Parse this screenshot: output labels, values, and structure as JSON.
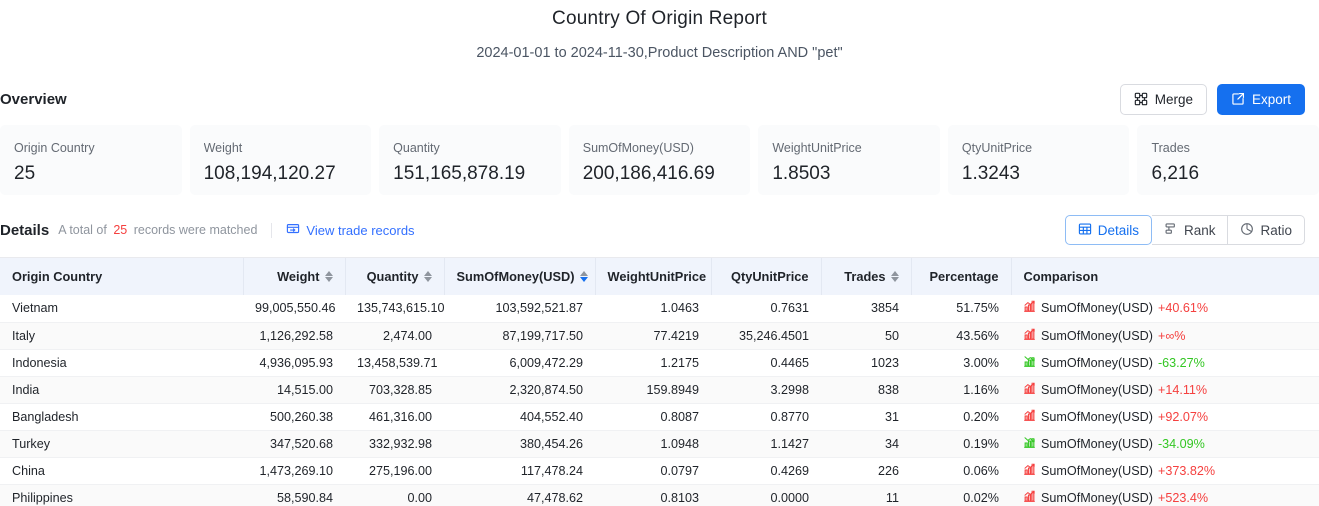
{
  "report": {
    "title": "Country Of Origin Report",
    "subtitle": "2024-01-01 to 2024-11-30,Product Description AND \"pet\""
  },
  "overview": {
    "label": "Overview",
    "merge_label": "Merge",
    "export_label": "Export",
    "cards": [
      {
        "label": "Origin Country",
        "value": "25"
      },
      {
        "label": "Weight",
        "value": "108,194,120.27"
      },
      {
        "label": "Quantity",
        "value": "151,165,878.19"
      },
      {
        "label": "SumOfMoney(USD)",
        "value": "200,186,416.69"
      },
      {
        "label": "WeightUnitPrice",
        "value": "1.8503"
      },
      {
        "label": "QtyUnitPrice",
        "value": "1.3243"
      },
      {
        "label": "Trades",
        "value": "6,216"
      }
    ]
  },
  "details": {
    "title": "Details",
    "meta_prefix": "A total of",
    "count": "25",
    "meta_suffix": "records were matched",
    "trade_link": "View trade records",
    "views": [
      {
        "label": "Details",
        "icon": "grid-icon",
        "active": true
      },
      {
        "label": "Rank",
        "icon": "rank-icon",
        "active": false
      },
      {
        "label": "Ratio",
        "icon": "pie-icon",
        "active": false
      }
    ]
  },
  "table": {
    "columns": [
      {
        "label": "Origin Country",
        "align": "left",
        "sortable": false,
        "sort": "none"
      },
      {
        "label": "Weight",
        "align": "right",
        "sortable": true,
        "sort": "none"
      },
      {
        "label": "Quantity",
        "align": "right",
        "sortable": true,
        "sort": "none"
      },
      {
        "label": "SumOfMoney(USD)",
        "align": "right",
        "sortable": true,
        "sort": "desc"
      },
      {
        "label": "WeightUnitPrice",
        "align": "right",
        "sortable": false,
        "sort": "none"
      },
      {
        "label": "QtyUnitPrice",
        "align": "right",
        "sortable": false,
        "sort": "none"
      },
      {
        "label": "Trades",
        "align": "right",
        "sortable": true,
        "sort": "none"
      },
      {
        "label": "Percentage",
        "align": "right",
        "sortable": false,
        "sort": "none"
      },
      {
        "label": "Comparison",
        "align": "left",
        "sortable": false,
        "sort": "none"
      }
    ],
    "rows": [
      {
        "country": "Vietnam",
        "weight": "99,005,550.46",
        "quantity": "135,743,615.10",
        "sum_of_money": "103,592,521.87",
        "weight_unit_price": "1.0463",
        "qty_unit_price": "0.7631",
        "trades": "3854",
        "percentage": "51.75%",
        "comparison_label": "SumOfMoney(USD)",
        "comparison_delta": "+40.61%",
        "direction": "up"
      },
      {
        "country": "Italy",
        "weight": "1,126,292.58",
        "quantity": "2,474.00",
        "sum_of_money": "87,199,717.50",
        "weight_unit_price": "77.4219",
        "qty_unit_price": "35,246.4501",
        "trades": "50",
        "percentage": "43.56%",
        "comparison_label": "SumOfMoney(USD)",
        "comparison_delta": "+∞%",
        "direction": "up"
      },
      {
        "country": "Indonesia",
        "weight": "4,936,095.93",
        "quantity": "13,458,539.71",
        "sum_of_money": "6,009,472.29",
        "weight_unit_price": "1.2175",
        "qty_unit_price": "0.4465",
        "trades": "1023",
        "percentage": "3.00%",
        "comparison_label": "SumOfMoney(USD)",
        "comparison_delta": "-63.27%",
        "direction": "down"
      },
      {
        "country": "India",
        "weight": "14,515.00",
        "quantity": "703,328.85",
        "sum_of_money": "2,320,874.50",
        "weight_unit_price": "159.8949",
        "qty_unit_price": "3.2998",
        "trades": "838",
        "percentage": "1.16%",
        "comparison_label": "SumOfMoney(USD)",
        "comparison_delta": "+14.11%",
        "direction": "up"
      },
      {
        "country": "Bangladesh",
        "weight": "500,260.38",
        "quantity": "461,316.00",
        "sum_of_money": "404,552.40",
        "weight_unit_price": "0.8087",
        "qty_unit_price": "0.8770",
        "trades": "31",
        "percentage": "0.20%",
        "comparison_label": "SumOfMoney(USD)",
        "comparison_delta": "+92.07%",
        "direction": "up"
      },
      {
        "country": "Turkey",
        "weight": "347,520.68",
        "quantity": "332,932.98",
        "sum_of_money": "380,454.26",
        "weight_unit_price": "1.0948",
        "qty_unit_price": "1.1427",
        "trades": "34",
        "percentage": "0.19%",
        "comparison_label": "SumOfMoney(USD)",
        "comparison_delta": "-34.09%",
        "direction": "down"
      },
      {
        "country": "China",
        "weight": "1,473,269.10",
        "quantity": "275,196.00",
        "sum_of_money": "117,478.24",
        "weight_unit_price": "0.0797",
        "qty_unit_price": "0.4269",
        "trades": "226",
        "percentage": "0.06%",
        "comparison_label": "SumOfMoney(USD)",
        "comparison_delta": "+373.82%",
        "direction": "up"
      },
      {
        "country": "Philippines",
        "weight": "58,590.84",
        "quantity": "0.00",
        "sum_of_money": "47,478.62",
        "weight_unit_price": "0.8103",
        "qty_unit_price": "0.0000",
        "trades": "11",
        "percentage": "0.02%",
        "comparison_label": "SumOfMoney(USD)",
        "comparison_delta": "+523.4%",
        "direction": "up"
      }
    ]
  },
  "colors": {
    "accent": "#1570ef",
    "link": "#3370ff",
    "up": "#f5403f",
    "down": "#34c724",
    "header_bg": "#f0f4fc",
    "card_bg": "#fafbfc"
  }
}
